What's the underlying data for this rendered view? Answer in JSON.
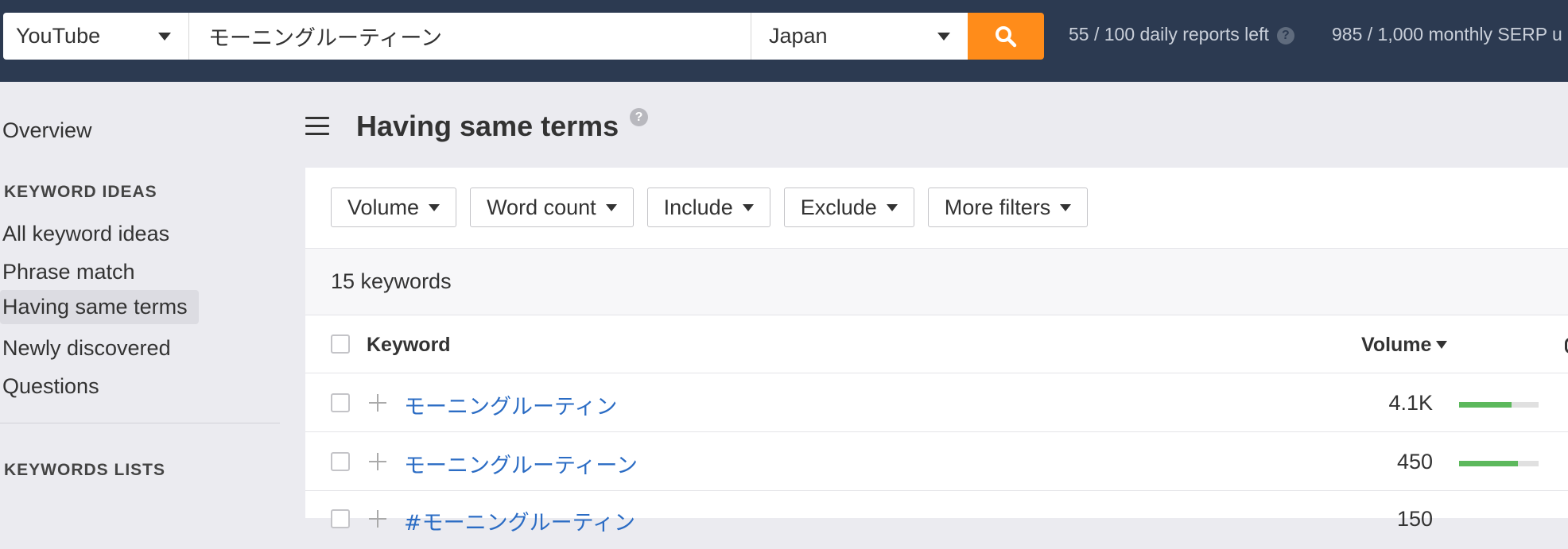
{
  "topbar": {
    "source": "YouTube",
    "query": "モーニングルーティーン",
    "country": "Japan",
    "daily_reports": "55 / 100 daily reports left",
    "monthly_serp": "985 / 1,000 monthly SERP u",
    "help_glyph": "?"
  },
  "sidebar": {
    "overview": "Overview",
    "keyword_ideas_heading": "KEYWORD IDEAS",
    "items": [
      "All keyword ideas",
      "Phrase match",
      "Having same terms",
      "Newly discovered",
      "Questions"
    ],
    "keywords_lists_heading": "KEYWORDS LISTS"
  },
  "main": {
    "title": "Having same terms",
    "help_glyph": "?",
    "filters": [
      "Volume",
      "Word count",
      "Include",
      "Exclude",
      "More filters"
    ],
    "keyword_count": "15 keywords",
    "columns": {
      "keyword": "Keyword",
      "volume": "Volume"
    },
    "rows": [
      {
        "keyword": "モーニングルーティン",
        "volume": "4.1K",
        "volume_fill": 0.66
      },
      {
        "keyword": "モーニングルーティーン",
        "volume": "450",
        "volume_fill": 0.74
      },
      {
        "keyword": "#モーニングルーティン",
        "volume": "150"
      }
    ]
  },
  "colors": {
    "topbar_bg": "#2c3a51",
    "search_button": "#ff8c1a",
    "link": "#2b6cc4",
    "volume_bar": "#5cb85c"
  }
}
